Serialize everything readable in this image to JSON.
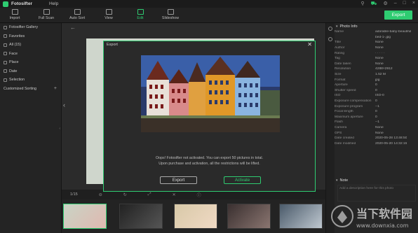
{
  "app": {
    "name": "Fotosifter",
    "menu_help": "Help"
  },
  "toolbar": {
    "tools": [
      {
        "label": "Import",
        "icon": "import-icon"
      },
      {
        "label": "Full Scan",
        "icon": "scan-icon"
      },
      {
        "label": "Auto Sort",
        "icon": "auto-sort-icon"
      },
      {
        "label": "View",
        "icon": "view-icon"
      },
      {
        "label": "Edit",
        "icon": "edit-icon"
      },
      {
        "label": "Slideshow",
        "icon": "slideshow-icon"
      }
    ],
    "export_label": "Export"
  },
  "sidebar": {
    "items": [
      {
        "label": "Fotosifter Gallery"
      },
      {
        "label": "Favorites"
      },
      {
        "label": "All (15)"
      },
      {
        "label": "Face"
      },
      {
        "label": "Place"
      },
      {
        "label": "Date"
      },
      {
        "label": "Selection"
      },
      {
        "label": "Customized Sorting",
        "plus": "+"
      }
    ]
  },
  "viewer": {
    "page_indicator": "1/15"
  },
  "photo_info": {
    "header": "Photo Info",
    "rows": [
      {
        "k": "Name",
        "v": "adorable-baby-beautiful"
      },
      {
        "k": "",
        "v": "bed-1-.jpg"
      },
      {
        "k": "Title",
        "v": "None"
      },
      {
        "k": "Author",
        "v": "None"
      },
      {
        "k": "Rating",
        "v": "· · · · ·"
      },
      {
        "k": "Tag",
        "v": "None"
      },
      {
        "k": "Date taken",
        "v": "None"
      },
      {
        "k": "Resolution",
        "v": "4288×2912"
      },
      {
        "k": "Size",
        "v": "1.52 M"
      },
      {
        "k": "Format",
        "v": "jpg"
      },
      {
        "k": "Aperture",
        "v": "0"
      },
      {
        "k": "Shutter speed",
        "v": "0"
      },
      {
        "k": "ISO",
        "v": "ISO-0"
      },
      {
        "k": "Exposure compensation",
        "v": "0"
      },
      {
        "k": "Exposure program",
        "v": "--1"
      },
      {
        "k": "Focal length",
        "v": "0"
      },
      {
        "k": "Maximum aperture",
        "v": "0"
      },
      {
        "k": "Flash",
        "v": "--1"
      },
      {
        "k": "Camera",
        "v": "None"
      },
      {
        "k": "GPS",
        "v": "None"
      },
      {
        "k": "Date created",
        "v": "2020-05-28 13:48:50"
      },
      {
        "k": "Date modified",
        "v": "2020-05-20 14:32:15"
      }
    ],
    "note_header": "Note",
    "note_placeholder": "Add a description here for this photo"
  },
  "modal": {
    "title": "Export",
    "message_line1": "Oops! Fotosifter not activated. You can export 50 pictures in total.",
    "message_line2": "Upon purchase and activation, all the restrictions will be lifted.",
    "export_button": "Export",
    "activate_button": "Activate"
  },
  "watermark": {
    "cn": "当下软件园",
    "url": "www.downxia.com"
  },
  "colors": {
    "accent": "#2ecc71",
    "background": "#1e1e1e"
  }
}
